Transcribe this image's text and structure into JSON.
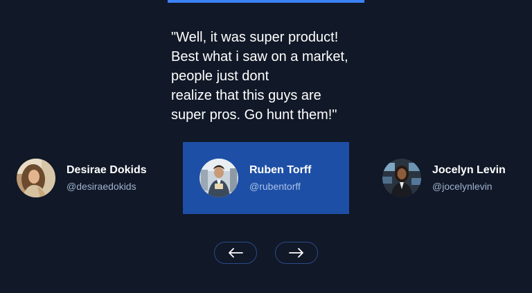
{
  "testimonial": {
    "quote_lines": [
      "\"Well, it was super product!",
      "Best what i saw on a market,",
      "people just dont",
      "realize that this guys are",
      "super pros. Go hunt them!\""
    ]
  },
  "people": [
    {
      "name": "Desirae Dokids",
      "handle": "@desiraedokids",
      "avatar": "woman-with-long-hair-avatar",
      "active": false
    },
    {
      "name": "Ruben Torff",
      "handle": "@rubentorff",
      "avatar": "man-in-suit-avatar",
      "active": true
    },
    {
      "name": "Jocelyn Levin",
      "handle": "@jocelynlevin",
      "avatar": "woman-in-suit-avatar",
      "active": false
    }
  ],
  "navigation": {
    "prev_icon": "arrow-left-icon",
    "next_icon": "arrow-right-icon"
  },
  "colors": {
    "background": "#111827",
    "accent": "#3b82f6",
    "active_card": "#1e4fa6",
    "button_border": "#2a4a8c",
    "handle_text": "#9fb3cf"
  }
}
